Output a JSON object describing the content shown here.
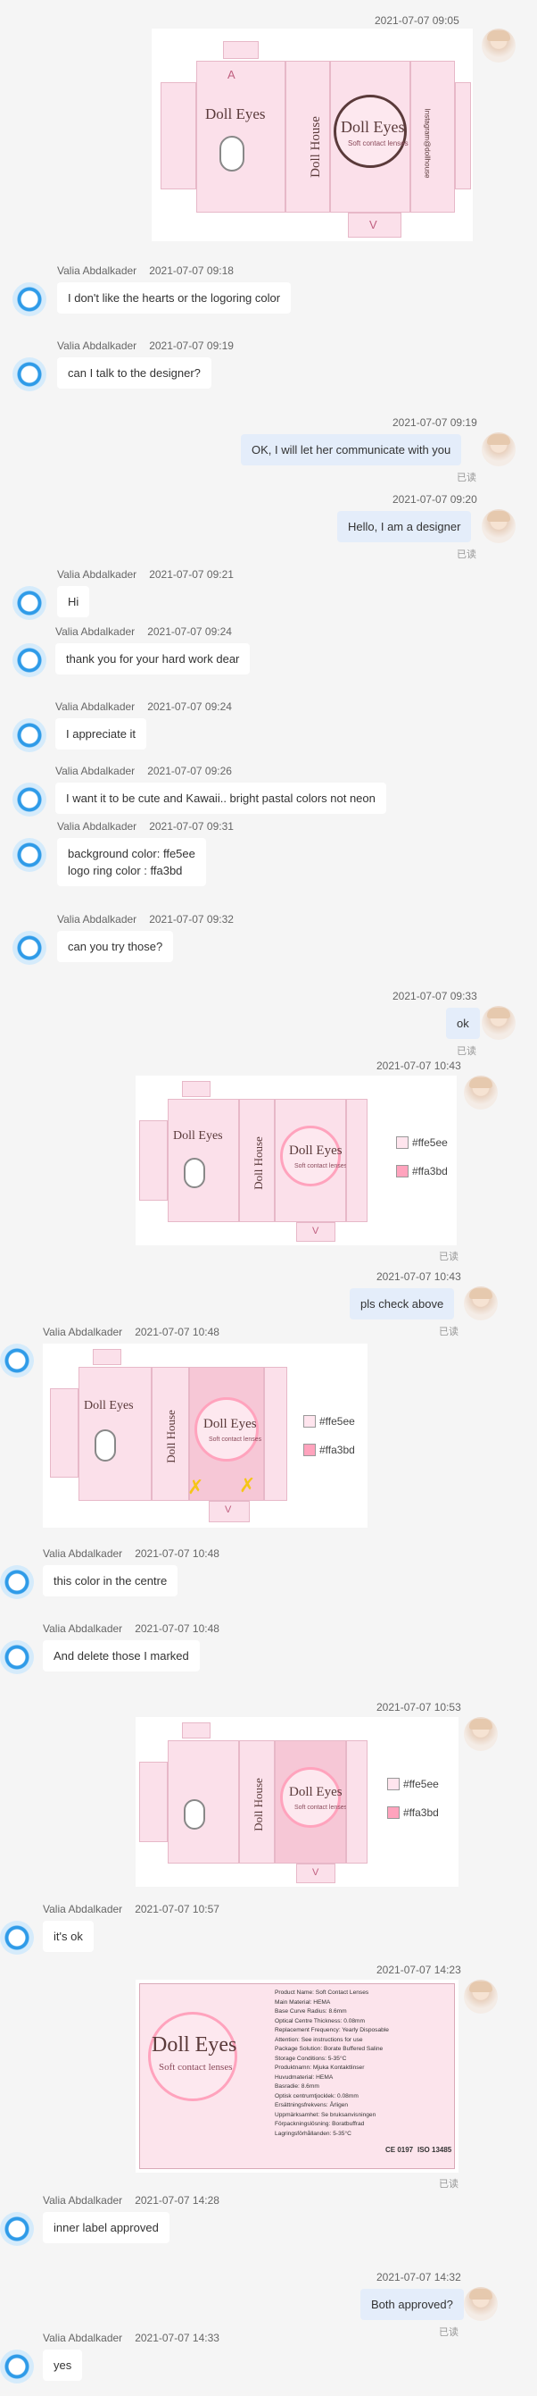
{
  "messages": [
    {
      "id": "m1",
      "time": "2021-07-07 09:05"
    },
    {
      "id": "m2",
      "name": "Valia Abdalkader",
      "time": "2021-07-07 09:18",
      "text": "I don't like the hearts or the logoring color"
    },
    {
      "id": "m3",
      "name": "Valia Abdalkader",
      "time": "2021-07-07 09:19",
      "text": "can I talk to the designer?"
    },
    {
      "id": "m4",
      "time": "2021-07-07 09:19",
      "text": "OK, I will let her communicate with you",
      "read": "已读"
    },
    {
      "id": "m5",
      "time": "2021-07-07 09:20",
      "text": "Hello, I am a designer",
      "read": "已读"
    },
    {
      "id": "m6",
      "name": "Valia Abdalkader",
      "time": "2021-07-07 09:21",
      "text": "Hi"
    },
    {
      "id": "m7",
      "name": "Valia Abdalkader",
      "time": "2021-07-07 09:24",
      "text": "thank you for your hard work dear"
    },
    {
      "id": "m8",
      "name": "Valia Abdalkader",
      "time": "2021-07-07 09:24",
      "text": "I appreciate it"
    },
    {
      "id": "m9",
      "name": "Valia Abdalkader",
      "time": "2021-07-07 09:26",
      "text": "I want it to be cute and Kawaii.. bright pastal colors not neon"
    },
    {
      "id": "m10",
      "name": "Valia Abdalkader",
      "time": "2021-07-07 09:31",
      "line1": "background color: ffe5ee",
      "line2": "logo ring color : ffa3bd"
    },
    {
      "id": "m11",
      "name": "Valia Abdalkader",
      "time": "2021-07-07 09:32",
      "text": "can you try those?"
    },
    {
      "id": "m12",
      "time": "2021-07-07 09:33",
      "text": "ok",
      "read": "已读"
    },
    {
      "id": "m13",
      "time": "2021-07-07 10:43",
      "read": "已读"
    },
    {
      "id": "m14",
      "time": "2021-07-07 10:43",
      "text": "pls check above",
      "read": "已读"
    },
    {
      "id": "m15",
      "name": "Valia Abdalkader",
      "time": "2021-07-07 10:48"
    },
    {
      "id": "m16",
      "name": "Valia Abdalkader",
      "time": "2021-07-07 10:48",
      "text": "this color in the centre"
    },
    {
      "id": "m17",
      "name": "Valia Abdalkader",
      "time": "2021-07-07 10:48",
      "text": "And delete those I marked"
    },
    {
      "id": "m18",
      "time": "2021-07-07 10:53"
    },
    {
      "id": "m19",
      "name": "Valia Abdalkader",
      "time": "2021-07-07 10:57",
      "text": "it's ok"
    },
    {
      "id": "m20",
      "time": "2021-07-07 14:23",
      "read": "已读"
    },
    {
      "id": "m21",
      "name": "Valia Abdalkader",
      "time": "2021-07-07 14:28",
      "text": "inner label approved"
    },
    {
      "id": "m22",
      "time": "2021-07-07 14:32",
      "text": "Both approved?",
      "read": "已读"
    },
    {
      "id": "m23",
      "name": "Valia Abdalkader",
      "time": "2021-07-07 14:33",
      "text": "yes"
    }
  ],
  "box": {
    "brand": "Doll Eyes",
    "tagline": "Soft contact lenses",
    "side_brand": "Doll House",
    "side_note": "Instagram@dollhouse",
    "letter_a": "A",
    "letter_v": "V"
  },
  "swatches": {
    "bg": {
      "label": "#ffe5ee",
      "color": "#ffe5ee"
    },
    "ring": {
      "label": "#ffa3bd",
      "color": "#ffa3bd"
    }
  },
  "label": {
    "brand": "Doll Eyes",
    "tagline": "Soft contact lenses",
    "ce": "CE 0197",
    "iso": "ISO 13485",
    "rows": [
      "Product Name: Soft Contact Lenses",
      "Main Material: HEMA",
      "Base Curve Radius: 8.6mm",
      "Optical Centre Thickness: 0.08mm",
      "Replacement Frequency: Yearly Disposable",
      "Attention: See instructions for use",
      "Package Solution: Borate Buffered Saline",
      "Storage Conditions: 5-35°C",
      "Produktnamn: Mjuka Kontaktlinser",
      "Huvudmaterial: HEMA",
      "Basradie: 8.6mm",
      "Optisk centrumtjocklek: 0.08mm",
      "Ersättningsfrekvens: Årligen",
      "Uppmärksamhet: Se bruksanvisningen",
      "Förpackningslösning: Boratbuffrad",
      "Lagringsförhållanden: 5-35°C"
    ]
  }
}
